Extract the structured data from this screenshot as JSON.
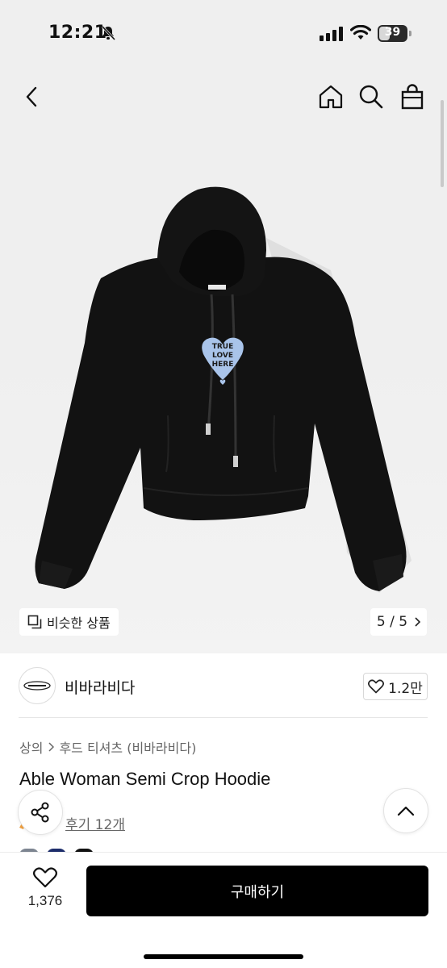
{
  "status_bar": {
    "time": "12:21",
    "battery_level": "39",
    "battery_fraction": 0.39
  },
  "header": {
    "back_icon": "chevron-left-icon",
    "home_icon": "home-icon",
    "search_icon": "search-icon",
    "bag_icon": "shopping-bag-icon"
  },
  "gallery": {
    "similar_label": "비슷한 상품",
    "page_indicator": "5 / 5"
  },
  "brand": {
    "name": "비바라비다",
    "likes": "1.2만"
  },
  "product": {
    "breadcrumb": [
      "상의",
      "후드 티셔츠 (비바라비다)"
    ],
    "title": "Able Woman Semi Crop Hoodie",
    "review_link": "후기 12개",
    "print_text": [
      "TRUE",
      "LOVE",
      "HERE"
    ]
  },
  "bottom_bar": {
    "wish_count": "1,376",
    "buy_label": "구매하기"
  },
  "colors": {
    "accent": "#000000",
    "background_top": "#efefef",
    "heart_print": "#a9c4ea"
  }
}
